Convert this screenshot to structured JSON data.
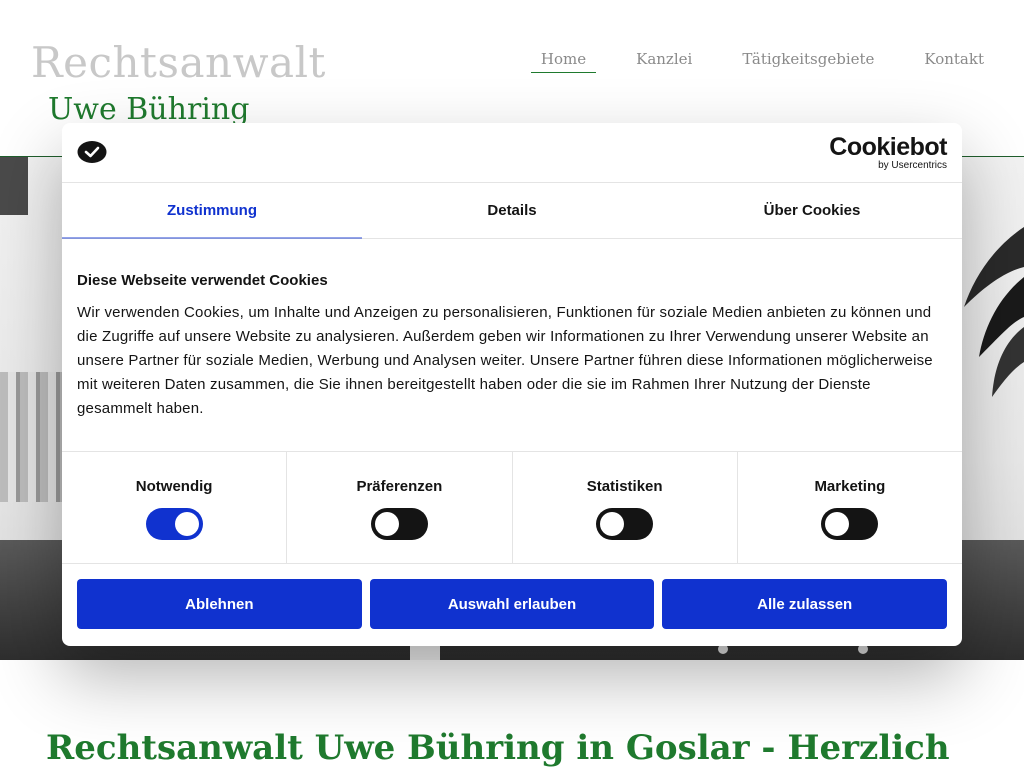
{
  "site": {
    "brand_line1": "Rechtsanwalt",
    "brand_line2": "Uwe Bühring",
    "nav": [
      {
        "label": "Home",
        "active": true
      },
      {
        "label": "Kanzlei",
        "active": false
      },
      {
        "label": "Tätigkeitsgebiete",
        "active": false
      },
      {
        "label": "Kontakt",
        "active": false
      }
    ],
    "page_heading": "Rechtsanwalt Uwe Bühring in Goslar - Herzlich",
    "colors": {
      "brand_green": "#1f7a2e",
      "accent_blue": "#1032cf"
    }
  },
  "cookie_dialog": {
    "brand_name": "Cookiebot",
    "brand_sub": "by Usercentrics",
    "tabs": [
      {
        "label": "Zustimmung",
        "active": true
      },
      {
        "label": "Details",
        "active": false
      },
      {
        "label": "Über Cookies",
        "active": false
      }
    ],
    "title": "Diese Webseite verwendet Cookies",
    "body": "Wir verwenden Cookies, um Inhalte und Anzeigen zu personalisieren, Funktionen für soziale Medien anbieten zu können und die Zugriffe auf unsere Website zu analysieren. Außerdem geben wir Informationen zu Ihrer Verwendung unserer Website an unsere Partner für soziale Medien, Werbung und Analysen weiter. Unsere Partner führen diese Informationen möglicherweise mit weiteren Daten zusammen, die Sie ihnen bereitgestellt haben oder die sie im Rahmen Ihrer Nutzung der Dienste gesammelt haben.",
    "toggles": [
      {
        "label": "Notwendig",
        "on": true
      },
      {
        "label": "Präferenzen",
        "on": false
      },
      {
        "label": "Statistiken",
        "on": false
      },
      {
        "label": "Marketing",
        "on": false
      }
    ],
    "buttons": {
      "decline": "Ablehnen",
      "allow_selection": "Auswahl erlauben",
      "allow_all": "Alle zulassen"
    }
  }
}
